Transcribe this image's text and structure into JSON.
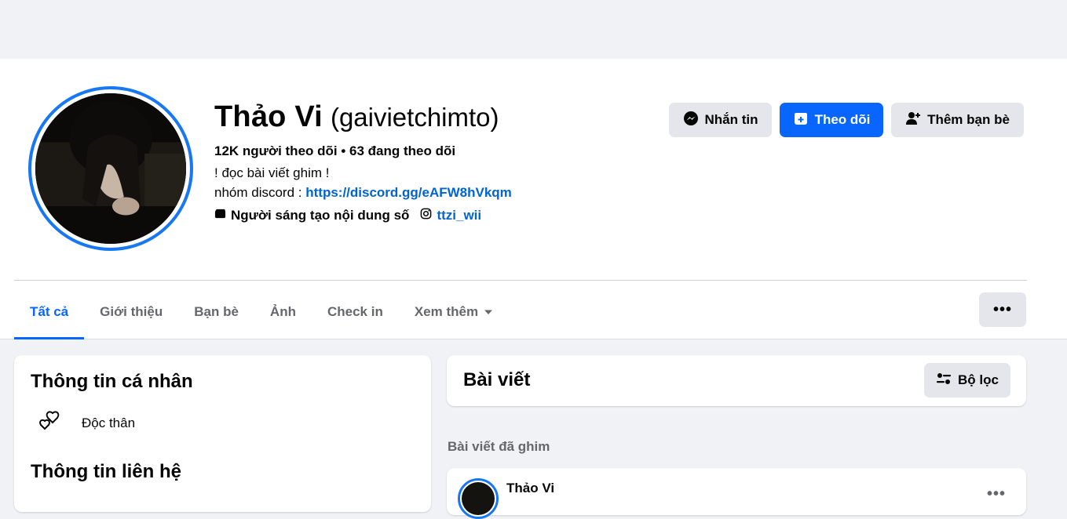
{
  "profile": {
    "name": "Thảo Vi",
    "username": "(gaivietchimto)",
    "stats": "12K người theo dõi • 63 đang theo dõi",
    "bio_line1": "! đọc bài viết ghim !",
    "bio_line2_prefix": "nhóm discord : ",
    "bio_link": "https://discord.gg/eAFW8hVkqm",
    "category": "Người sáng tạo nội dung số",
    "instagram": "ttzi_wii"
  },
  "actions": {
    "message_label": "Nhắn tin",
    "follow_label": "Theo dõi",
    "add_friend_label": "Thêm bạn bè"
  },
  "tabs": [
    {
      "label": "Tất cả",
      "active": true
    },
    {
      "label": "Giới thiệu",
      "active": false
    },
    {
      "label": "Bạn bè",
      "active": false
    },
    {
      "label": "Ảnh",
      "active": false
    },
    {
      "label": "Check in",
      "active": false
    },
    {
      "label": "Xem thêm",
      "active": false
    }
  ],
  "more_button": "•••",
  "intro": {
    "personal_title": "Thông tin cá nhân",
    "relationship": "Độc thân",
    "contact_title": "Thông tin liên hệ"
  },
  "posts": {
    "title": "Bài viết",
    "filter_label": "Bộ lọc",
    "pinned_label": "Bài viết đã ghim",
    "pinned_author": "Thảo Vi",
    "pinned_more": "•••"
  },
  "colors": {
    "accent": "#0866ff",
    "ring": "#1877f2",
    "link": "#0064d1"
  }
}
